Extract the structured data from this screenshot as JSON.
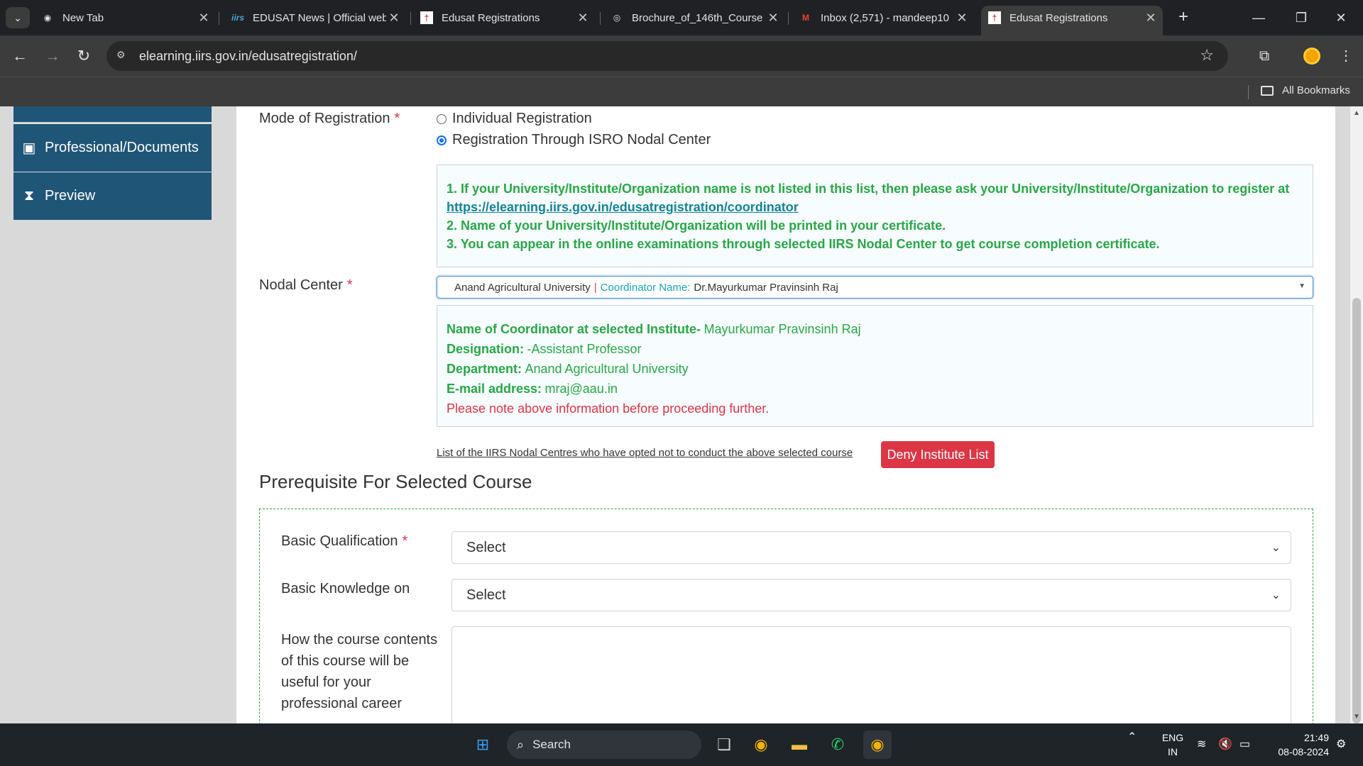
{
  "browser": {
    "tabs": [
      {
        "title": "New Tab",
        "favicon": "chrome-icon"
      },
      {
        "title": "EDUSAT News | Official website",
        "favicon": "iirs-icon"
      },
      {
        "title": "Edusat Registrations",
        "favicon": "iirs-logo-icon"
      },
      {
        "title": "Brochure_of_146th_Course",
        "favicon": "globe-icon"
      },
      {
        "title": "Inbox (2,571) - mandeep10",
        "favicon": "gmail-icon"
      },
      {
        "title": "Edusat Registrations",
        "favicon": "iirs-logo-icon",
        "active": true
      }
    ],
    "url": "elearning.iirs.gov.in/edusatregistration/",
    "all_bookmarks": "All Bookmarks"
  },
  "sidebar": {
    "items": [
      {
        "label": "Professional/Documents",
        "icon": "id-card-icon"
      },
      {
        "label": "Preview",
        "icon": "hourglass-icon"
      }
    ]
  },
  "form": {
    "mode": {
      "label": "Mode of Registration",
      "options": [
        "Individual Registration",
        "Registration Through ISRO Nodal Center"
      ],
      "selected": 1
    },
    "notice": {
      "line1": "1. If your University/Institute/Organization name is not listed in this list, then please ask your University/Institute/Organization to register at",
      "link": "https://elearning.iirs.gov.in/edusatregistration/coordinator",
      "line2": "2. Name of your University/Institute/Organization will be printed in your certificate.",
      "line3": "3. You can appear in the online examinations through selected IIRS Nodal Center to get course completion certificate."
    },
    "nodal": {
      "label": "Nodal Center",
      "institute": "Anand Agricultural University",
      "separator": "|",
      "coordinator_label": "Coordinator Name:",
      "coordinator_value": "Dr.Mayurkumar Pravinsinh Raj"
    },
    "coordinator_info": {
      "name_label": "Name of Coordinator at selected Institute-",
      "name_value": "Mayurkumar Pravinsinh Raj",
      "designation_label": "Designation:",
      "designation_value": "-Assistant Professor",
      "department_label": "Department:",
      "department_value": "Anand Agricultural University",
      "email_label": "E-mail address:",
      "email_value": "mraj@aau.in",
      "warning": "Please note above information before proceeding further."
    },
    "deny": {
      "link_text": "List of the IIRS Nodal Centres who have opted not to conduct the above selected course",
      "button": "Deny Institute List"
    },
    "prereq": {
      "title": "Prerequisite For Selected Course",
      "qualification_label": "Basic Qualification",
      "qualification_value": "Select",
      "knowledge_label": "Basic Knowledge on",
      "knowledge_value": "Select",
      "usefulness_label_1": "How the course contents",
      "usefulness_label_2": "of this course will be",
      "usefulness_label_3": "useful for your",
      "usefulness_label_4": "professional career"
    },
    "required_mark": "*"
  },
  "taskbar": {
    "search": "Search",
    "lang_1": "ENG",
    "lang_2": "IN",
    "time": "21:49",
    "date": "08-08-2024"
  },
  "colors": {
    "sidebar_bg": "#1f5577",
    "green": "#28a745",
    "red": "#dc3545",
    "primary": "#0d6efd"
  }
}
